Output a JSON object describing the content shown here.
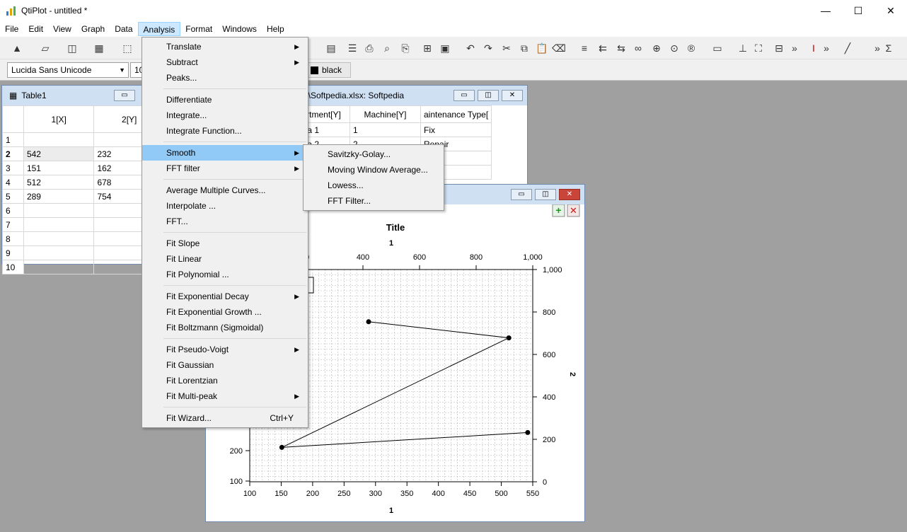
{
  "app": {
    "title": "QtiPlot - untitled *"
  },
  "window_buttons": {
    "minimize": "—",
    "maximize": "☐",
    "close": "✕"
  },
  "menubar": [
    "File",
    "Edit",
    "View",
    "Graph",
    "Data",
    "Analysis",
    "Format",
    "Windows",
    "Help"
  ],
  "format_bar": {
    "font": "Lucida Sans Unicode",
    "size": "10",
    "color_label": "black"
  },
  "table1": {
    "title": "Table1",
    "headers": [
      "1[X]",
      "2[Y]"
    ],
    "rows": [
      [
        "1",
        "",
        ""
      ],
      [
        "2",
        "542",
        "232"
      ],
      [
        "3",
        "151",
        "162"
      ],
      [
        "4",
        "512",
        "678"
      ],
      [
        "5",
        "289",
        "754"
      ],
      [
        "6",
        "",
        ""
      ],
      [
        "7",
        "",
        ""
      ],
      [
        "8",
        "",
        ""
      ],
      [
        "9",
        "",
        ""
      ],
      [
        "10",
        "",
        ""
      ]
    ]
  },
  "table2": {
    "title": "es\\Softpedia.xlsx: Softpedia",
    "headers": [
      "rtment[Y]",
      "Machine[Y]",
      "aintenance Type["
    ],
    "rows": [
      [
        "dia 1",
        "1",
        "Fix"
      ],
      [
        "dia 2",
        "2",
        "Repair"
      ],
      [
        "",
        "",
        "k"
      ],
      [
        "",
        "",
        ""
      ]
    ]
  },
  "analysis_menu": [
    {
      "label": "Translate",
      "sub": true
    },
    {
      "label": "Subtract",
      "sub": true
    },
    {
      "label": "Peaks..."
    },
    {
      "sep": true
    },
    {
      "label": "Differentiate"
    },
    {
      "label": "Integrate..."
    },
    {
      "label": "Integrate Function..."
    },
    {
      "sep": true
    },
    {
      "label": "Smooth",
      "sub": true,
      "hl": true
    },
    {
      "label": "FFT filter",
      "sub": true
    },
    {
      "sep": true
    },
    {
      "label": "Average Multiple Curves..."
    },
    {
      "label": "Interpolate ..."
    },
    {
      "label": "FFT..."
    },
    {
      "sep": true
    },
    {
      "label": "Fit Slope"
    },
    {
      "label": "Fit Linear"
    },
    {
      "label": "Fit Polynomial ..."
    },
    {
      "sep": true
    },
    {
      "label": "Fit Exponential Decay",
      "sub": true
    },
    {
      "label": "Fit Exponential Growth ..."
    },
    {
      "label": "Fit Boltzmann (Sigmoidal)"
    },
    {
      "sep": true
    },
    {
      "label": "Fit Pseudo-Voigt",
      "sub": true
    },
    {
      "label": "Fit Gaussian"
    },
    {
      "label": "Fit Lorentzian"
    },
    {
      "label": "Fit Multi-peak",
      "sub": true
    },
    {
      "sep": true
    },
    {
      "label": "Fit Wizard...",
      "shortcut": "Ctrl+Y"
    }
  ],
  "smooth_submenu": [
    "Savitzky-Golay...",
    "Moving Window Average...",
    "Lowess...",
    "FFT Filter..."
  ],
  "graph": {
    "title": "Title",
    "bottom_axis_label": "1",
    "top_axis_label": "1",
    "right_axis_label": "2",
    "bottom_ticks": [
      "100",
      "150",
      "200",
      "250",
      "300",
      "350",
      "400",
      "450",
      "500",
      "550"
    ],
    "top_ticks": [
      "00",
      "400",
      "600",
      "800",
      "1,000"
    ],
    "right_ticks": [
      "1,000",
      "800",
      "600",
      "400",
      "200",
      "0"
    ],
    "left_ticks": [
      "200",
      "100"
    ]
  },
  "chart_data": {
    "type": "line",
    "title": "Title",
    "xlabel": "1",
    "ylabel": "2",
    "xlim": [
      100,
      550
    ],
    "x": [
      542,
      151,
      512,
      289
    ],
    "y": [
      232,
      162,
      678,
      754
    ]
  }
}
